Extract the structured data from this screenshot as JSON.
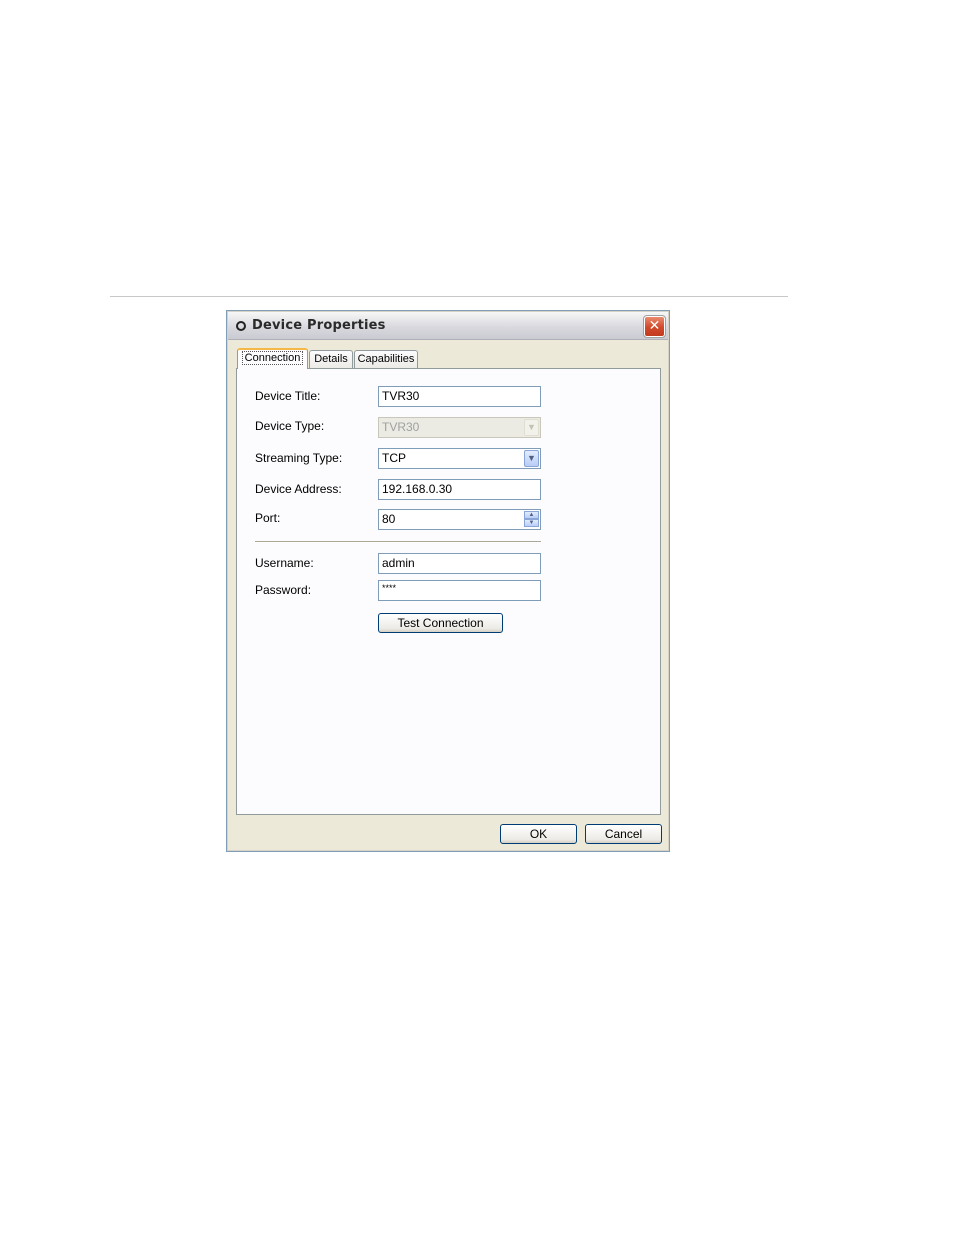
{
  "dialog": {
    "title": "Device Properties",
    "close_glyph": "✕"
  },
  "tabs": [
    {
      "label": "Connection",
      "active": true
    },
    {
      "label": "Details",
      "active": false
    },
    {
      "label": "Capabilities",
      "active": false
    }
  ],
  "form": {
    "device_title": {
      "label": "Device Title:",
      "value": "TVR30"
    },
    "device_type": {
      "label": "Device Type:",
      "value": "TVR30",
      "disabled": true
    },
    "streaming_type": {
      "label": "Streaming Type:",
      "value": "TCP"
    },
    "device_address": {
      "label": "Device Address:",
      "value": "192.168.0.30"
    },
    "port": {
      "label": "Port:",
      "value": "80"
    },
    "username": {
      "label": "Username:",
      "value": "admin"
    },
    "password": {
      "label": "Password:",
      "value": "****"
    },
    "test_connection_label": "Test Connection"
  },
  "buttons": {
    "ok": "OK",
    "cancel": "Cancel"
  },
  "icons": {
    "title_icon": "ring-icon",
    "dropdown_arrow": "chevron-down-icon",
    "spinner": "up-down-arrows-icon"
  }
}
